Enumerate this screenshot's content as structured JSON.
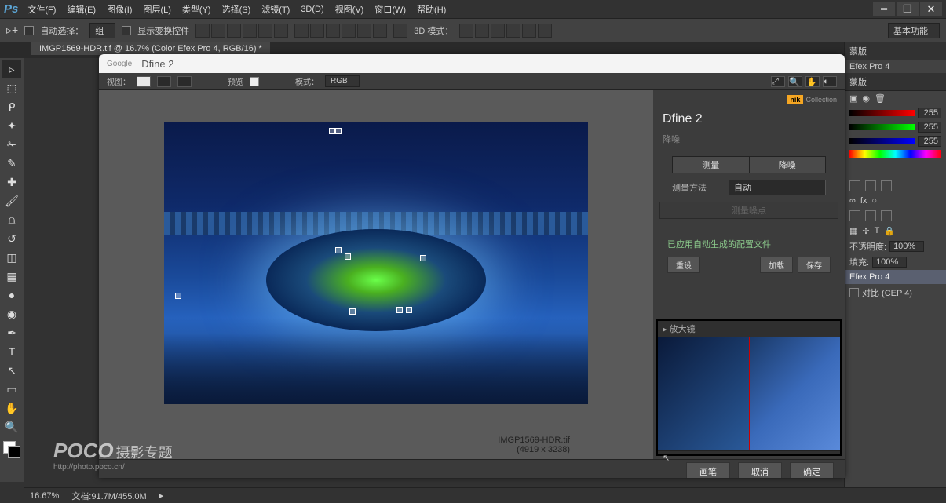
{
  "menubar": [
    "文件(F)",
    "编辑(E)",
    "图像(I)",
    "图层(L)",
    "类型(Y)",
    "选择(S)",
    "滤镜(T)",
    "3D(D)",
    "视图(V)",
    "窗口(W)",
    "帮助(H)"
  ],
  "optbar": {
    "auto_select": "自动选择：",
    "group": "组",
    "show_transform": "显示变换控件",
    "mode3d": "3D 模式：",
    "functions": "基本功能"
  },
  "tab": "IMGP1569-HDR.tif @ 16.7% (Color Efex Pro 4, RGB/16) *",
  "right": {
    "mask_hdr": "蒙版",
    "efex": "Efex Pro 4",
    "mask2": "蒙版",
    "rgb_vals": [
      "255",
      "255",
      "255"
    ],
    "opacity_lbl": "不透明度:",
    "opacity_val": "100%",
    "fill_lbl": "填充:",
    "fill_val": "100%",
    "layer_efex": "Efex Pro 4",
    "layer_comparison": "对比 (CEP 4)"
  },
  "dfine": {
    "google": "Google",
    "title": "Dfine 2",
    "toolbar": {
      "view": "视图：",
      "preview": "预览",
      "mode": "模式：",
      "rgb": "RGB"
    },
    "nik": {
      "brand": "nik",
      "coll": "Collection"
    },
    "product": "Dfine 2",
    "noise_hdr": "降噪",
    "seg": [
      "测量",
      "降噪"
    ],
    "method_lbl": "测量方法",
    "method_val": "自动",
    "measure_btn": "测量噪点",
    "status": "已应用自动生成的配置文件",
    "reset": "重设",
    "load": "加载",
    "save": "保存",
    "magnifier": "放大镜",
    "brush": "画笔",
    "cancel": "取消",
    "ok": "确定",
    "caption_name": "IMGP1569-HDR.tif",
    "caption_dims": "(4919 x 3238)"
  },
  "status": {
    "zoom": "16.67%",
    "doc": "文档:91.7M/455.0M"
  },
  "watermark": {
    "brand": "POCO",
    "cn": "摄影专题",
    "url": "http://photo.poco.cn/"
  }
}
